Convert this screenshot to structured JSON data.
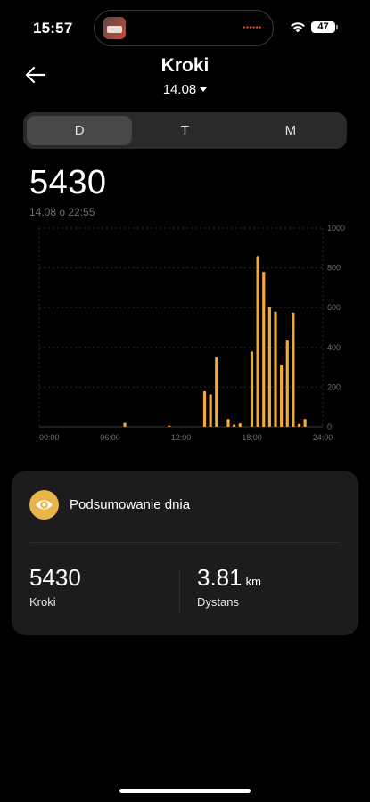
{
  "status_bar": {
    "time": "15:57",
    "battery": "47"
  },
  "header": {
    "title": "Kroki",
    "date": "14.08"
  },
  "tabs": [
    {
      "label": "D",
      "active": true
    },
    {
      "label": "T",
      "active": false
    },
    {
      "label": "M",
      "active": false
    }
  ],
  "main": {
    "value": "5430",
    "timestamp": "14.08 o 22:55"
  },
  "chart_data": {
    "type": "bar",
    "x_ticks": [
      "00:00",
      "06:00",
      "12:00",
      "18:00",
      "24:00"
    ],
    "y_ticks": [
      "0",
      "200",
      "400",
      "600",
      "800",
      "1000"
    ],
    "ylim": [
      0,
      1000
    ],
    "xlim_hours": [
      0,
      24
    ],
    "bar_color": "#f0a93c",
    "bars": [
      {
        "hour": 7.25,
        "value": 20
      },
      {
        "hour": 11.0,
        "value": 6
      },
      {
        "hour": 14.0,
        "value": 180
      },
      {
        "hour": 14.5,
        "value": 165
      },
      {
        "hour": 15.0,
        "value": 350
      },
      {
        "hour": 16.0,
        "value": 40
      },
      {
        "hour": 16.5,
        "value": 12
      },
      {
        "hour": 17.0,
        "value": 18
      },
      {
        "hour": 18.0,
        "value": 380
      },
      {
        "hour": 18.5,
        "value": 860
      },
      {
        "hour": 19.0,
        "value": 780
      },
      {
        "hour": 19.5,
        "value": 605
      },
      {
        "hour": 20.0,
        "value": 580
      },
      {
        "hour": 20.5,
        "value": 310
      },
      {
        "hour": 21.0,
        "value": 435
      },
      {
        "hour": 21.5,
        "value": 575
      },
      {
        "hour": 22.0,
        "value": 15
      },
      {
        "hour": 22.5,
        "value": 40
      }
    ]
  },
  "summary": {
    "title": "Podsumowanie dnia",
    "steps_value": "5430",
    "steps_label": "Kroki",
    "distance_value": "3.81",
    "distance_unit": "km",
    "distance_label": "Dystans"
  }
}
